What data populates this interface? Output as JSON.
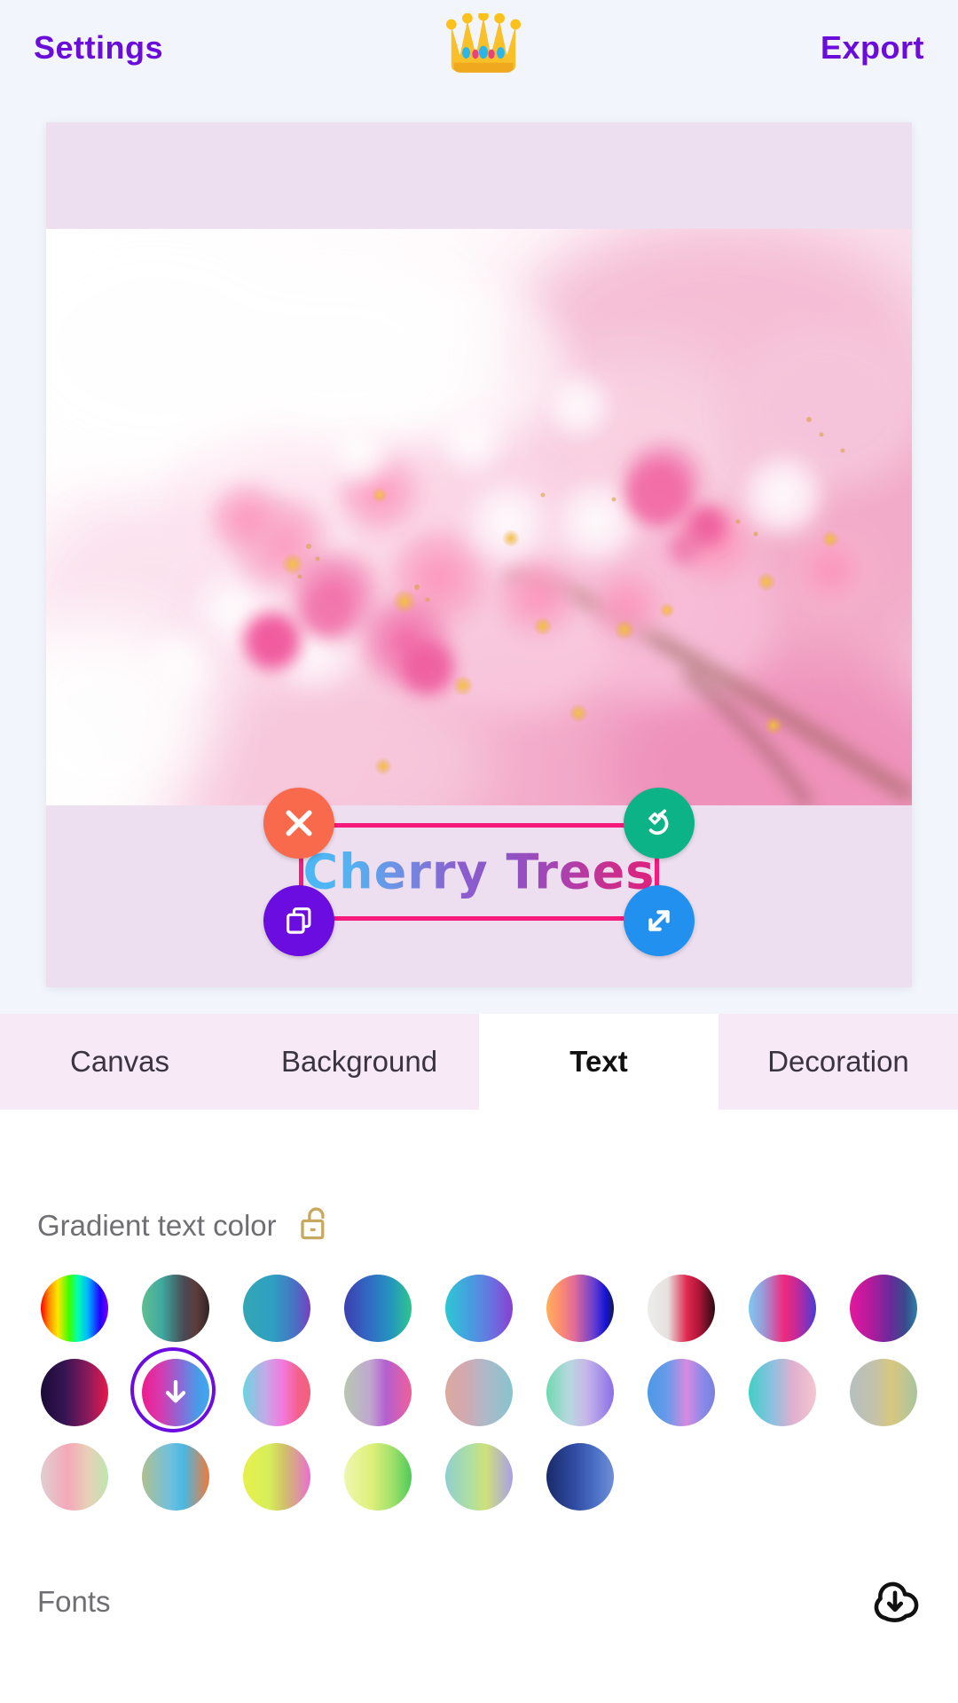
{
  "topbar": {
    "settings_label": "Settings",
    "export_label": "Export",
    "crown_icon": "crown-icon",
    "accent_color": "#6a0dda",
    "background": "#f2f5fc"
  },
  "canvas": {
    "card_background": "#eddff0",
    "photo_alt": "cherry blossom branch close-up",
    "text_object": {
      "content": "Cherry Trees",
      "gradient_from": "#4cb8f5",
      "gradient_to": "#e01f7a",
      "selection_border_color": "#f51a7b",
      "handles": [
        {
          "name": "delete-handle",
          "icon": "close-icon",
          "color": "#f96a4d"
        },
        {
          "name": "rotate-handle",
          "icon": "rotate-icon",
          "color": "#0cb387"
        },
        {
          "name": "duplicate-handle",
          "icon": "copy-icon",
          "color": "#6b0ce0"
        },
        {
          "name": "resize-handle",
          "icon": "resize-icon",
          "color": "#2290ee"
        }
      ]
    }
  },
  "tabs": [
    {
      "label": "Canvas",
      "active": false
    },
    {
      "label": "Background",
      "active": false
    },
    {
      "label": "Text",
      "active": true
    },
    {
      "label": "Decoration",
      "active": false
    }
  ],
  "panel": {
    "section_title": "Gradient text color",
    "lock_icon": "unlock-icon",
    "lock_color": "#c6a95e",
    "lock_state": "unlocked",
    "fonts_label": "Fonts",
    "fonts_download_icon": "download-cloud-icon",
    "selected_swatch_index": 10,
    "selected_swatch_icon": "download-arrow-icon",
    "swatches": [
      {
        "id": 0,
        "name": "rainbow",
        "css": "linear-gradient(90deg,#ff0000 0%,#ff8a00 12%,#ffe600 25%,#3dff00 42%,#00ffb3 55%,#00b3ff 70%,#2200ff 88%,#7a00ff 100%)"
      },
      {
        "id": 1,
        "name": "green-to-brown",
        "css": "linear-gradient(90deg,#5fbf8f 0%,#3fa9a0 30%,#4a4a55 62%,#5c3a3a 82%,#2e2424 100%)"
      },
      {
        "id": 2,
        "name": "teal-to-violet",
        "css": "linear-gradient(90deg,#33a7b5 0%,#2f9fc2 45%,#4a6fc4 78%,#7a3fc0 100%)"
      },
      {
        "id": 3,
        "name": "indigo-to-green",
        "css": "linear-gradient(90deg,#3b3fae 0%,#2f6fc4 40%,#2596bd 70%,#2fc58e 100%)"
      },
      {
        "id": 4,
        "name": "cyan-to-purple",
        "css": "linear-gradient(90deg,#2bc8d4 0%,#4a9ae0 40%,#6b6fe0 70%,#8a3fd0 100%)"
      },
      {
        "id": 5,
        "name": "orange-to-blue",
        "css": "linear-gradient(90deg,#ffb05c 0%,#fb8a72 22%,#e06a9a 42%,#6a3fd0 70%,#1414d6 88%,#17174a 100%)"
      },
      {
        "id": 6,
        "name": "white-crimson-black",
        "css": "linear-gradient(90deg,#ececea 0%,#e6e2df 30%,#e0294f 58%,#b01538 76%,#2a0c14 100%)"
      },
      {
        "id": 7,
        "name": "sky-pink-indigo",
        "css": "linear-gradient(90deg,#7ec8ef 0%,#9a9ad8 22%,#f02a7f 52%,#c02a9a 72%,#4a3ad6 100%)"
      },
      {
        "id": 8,
        "name": "magenta-to-teal",
        "css": "linear-gradient(90deg,#e5189f 0%,#b51a9c 30%,#6a2a9a 60%,#3a4a8a 82%,#2e7fa8 100%)"
      },
      {
        "id": 9,
        "name": "darkviolet-to-red",
        "css": "linear-gradient(90deg,#1a0b38 0%,#351452 35%,#8a1a5c 70%,#e8184a 100%)"
      },
      {
        "id": 10,
        "name": "magenta-to-sky",
        "css": "linear-gradient(90deg,#ef1b8e 0%,#d43bb0 28%,#8a6ad8 58%,#4a9ae8 82%,#3fa8f0 100%)"
      },
      {
        "id": 11,
        "name": "cyan-pink-coral",
        "css": "linear-gradient(90deg,#6ad4e0 0%,#c6a8e8 34%,#f27ae0 58%,#f4608c 82%,#f2607a 100%)"
      },
      {
        "id": 12,
        "name": "sage-violet-rose",
        "css": "linear-gradient(90deg,#b8c8b0 0%,#c0a8cf 38%,#b45fd0 62%,#ef5f9a 100%)"
      },
      {
        "id": 13,
        "name": "rose-to-teal",
        "css": "linear-gradient(90deg,#dba9a0 0%,#d3a8b0 28%,#b0b8c8 58%,#86c4cf 100%)"
      },
      {
        "id": 14,
        "name": "mint-to-violet",
        "css": "linear-gradient(90deg,#6fd9b0 0%,#b8d8e0 34%,#c8b8e8 58%,#8a6fe8 100%)"
      },
      {
        "id": 15,
        "name": "blue-to-pinkblue",
        "css": "linear-gradient(90deg,#4a9ae8 0%,#6a9ae8 30%,#d68ae0 58%,#8a8ae8 82%,#7a7fe0 100%)"
      },
      {
        "id": 16,
        "name": "turquoise-to-blush",
        "css": "linear-gradient(90deg,#3fd0c6 0%,#8ac0e0 34%,#e0b0cf 66%,#f4c6d0 100%)"
      },
      {
        "id": 17,
        "name": "sage-to-gold",
        "css": "linear-gradient(90deg,#b6bfc0 0%,#c4c2a8 38%,#d8c77f 62%,#a8c4a0 100%)"
      },
      {
        "id": 18,
        "name": "blush-to-mint",
        "css": "linear-gradient(90deg,#e0cfd0 0%,#f4a8b8 40%,#e8d0b8 70%,#bfe6b0 100%)"
      },
      {
        "id": 19,
        "name": "sage-cyan-orange",
        "css": "linear-gradient(90deg,#b0c090 0%,#6fc0e0 42%,#4ab8e0 62%,#ef7a3a 100%)"
      },
      {
        "id": 20,
        "name": "lime-to-magenta",
        "css": "linear-gradient(90deg,#e8f04a 0%,#d8ee5a 38%,#d0c06a 62%,#e86fd0 100%)"
      },
      {
        "id": 21,
        "name": "pale-lime-to-green",
        "css": "linear-gradient(90deg,#eef7b0 0%,#dff07a 40%,#9ee06a 72%,#4ecb5a 100%)"
      },
      {
        "id": 22,
        "name": "teal-lime-violet",
        "css": "linear-gradient(90deg,#8fd0cf 0%,#b0dfa0 38%,#cfe07a 60%,#a8a0e8 100%)"
      },
      {
        "id": 23,
        "name": "navy-to-blue",
        "css": "linear-gradient(90deg,#1a2a6a 0%,#2f4aa0 40%,#4a6fc4 72%,#6f8fd8 100%)"
      }
    ]
  }
}
